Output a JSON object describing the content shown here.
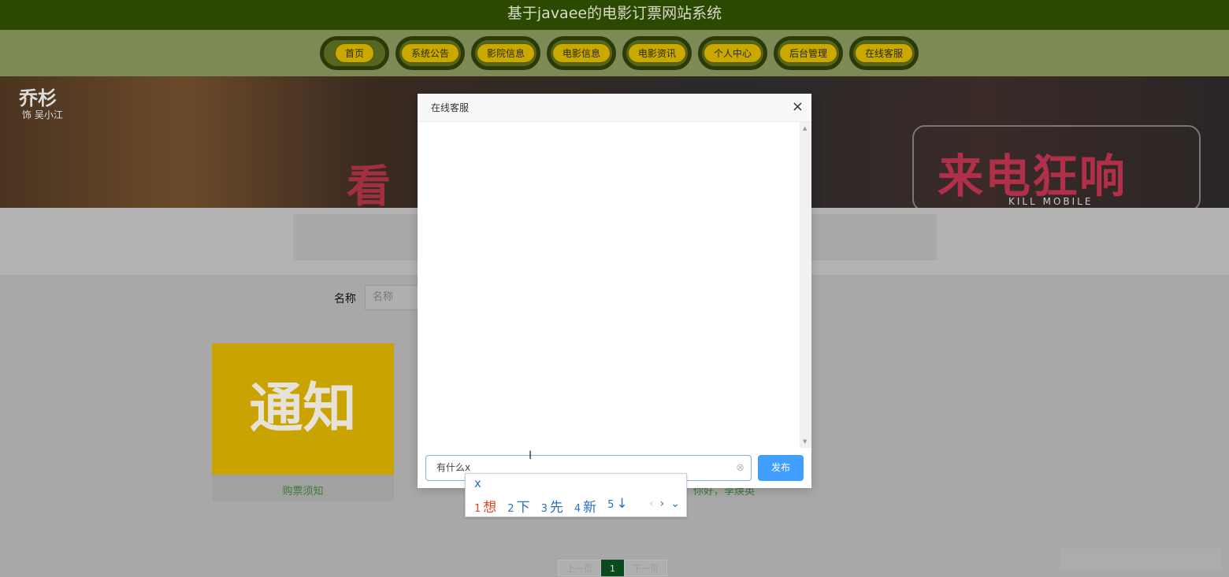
{
  "header": {
    "title": "基于javaee的电影订票网站系统"
  },
  "nav": [
    "首页",
    "系统公告",
    "影院信息",
    "电影信息",
    "电影资讯",
    "个人中心",
    "后台管理",
    "在线客服"
  ],
  "banner": {
    "actor": "乔杉",
    "role": "饰 吴小江",
    "movie": "来电狂响",
    "movie_en": "KILL MOBILE",
    "slogan": "看"
  },
  "search": {
    "label": "名称",
    "placeholder": "名称"
  },
  "cards": [
    {
      "image_text": "通知",
      "title": "购票须知"
    },
    {
      "title": "你好，李焕英"
    }
  ],
  "pagination": {
    "prev": "上一页",
    "current": "1",
    "next": "下一页"
  },
  "modal": {
    "title": "在线客服",
    "close": "×",
    "input_value": "有什么x",
    "send": "发布"
  },
  "ime": {
    "composition": "x",
    "candidates": [
      {
        "n": "1",
        "c": "想"
      },
      {
        "n": "2",
        "c": "下"
      },
      {
        "n": "3",
        "c": "先"
      },
      {
        "n": "4",
        "c": "新"
      },
      {
        "n": "5",
        "c": "↓"
      }
    ]
  }
}
